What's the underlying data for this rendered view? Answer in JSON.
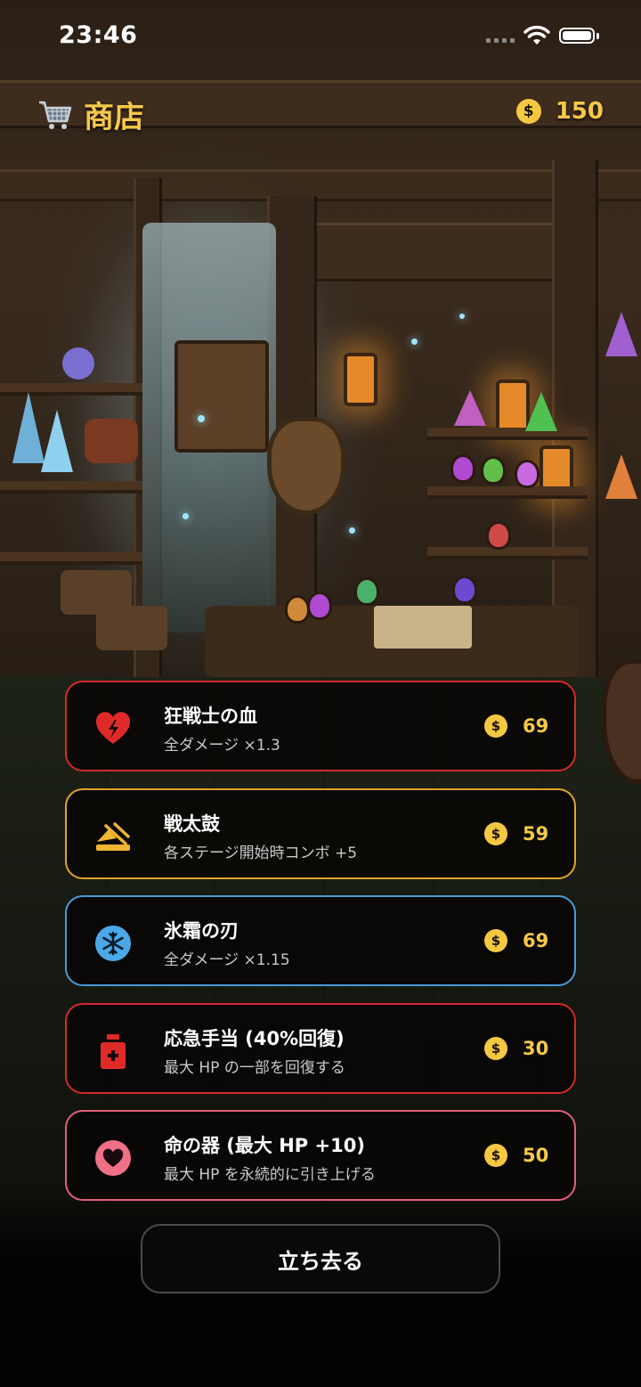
{
  "status_bar": {
    "time": "23:46"
  },
  "header": {
    "title": "商店",
    "cart_icon": "cart-icon",
    "coin_symbol": "$",
    "coins": "150"
  },
  "items": [
    {
      "name": "狂戦士の血",
      "description": "全ダメージ ×1.3",
      "price": "69",
      "icon": "broken-heart-icon",
      "color": "#d42a2a"
    },
    {
      "name": "戦太鼓",
      "description": "各ステージ開始時コンボ +5",
      "price": "59",
      "icon": "drum-icon",
      "color": "#e0a42a"
    },
    {
      "name": "氷霜の刃",
      "description": "全ダメージ ×1.15",
      "price": "69",
      "icon": "snowflake-icon",
      "color": "#4a9ad6"
    },
    {
      "name": "応急手当 (40%回復)",
      "description": "最大 HP の一部を回復する",
      "price": "30",
      "icon": "potion-icon",
      "color": "#d42a2a"
    },
    {
      "name": "命の器 (最大 HP +10)",
      "description": "最大 HP を永続的に引き上げる",
      "price": "50",
      "icon": "heart-icon",
      "color": "#e0607a"
    }
  ],
  "leave_button": {
    "label": "立ち去る"
  }
}
